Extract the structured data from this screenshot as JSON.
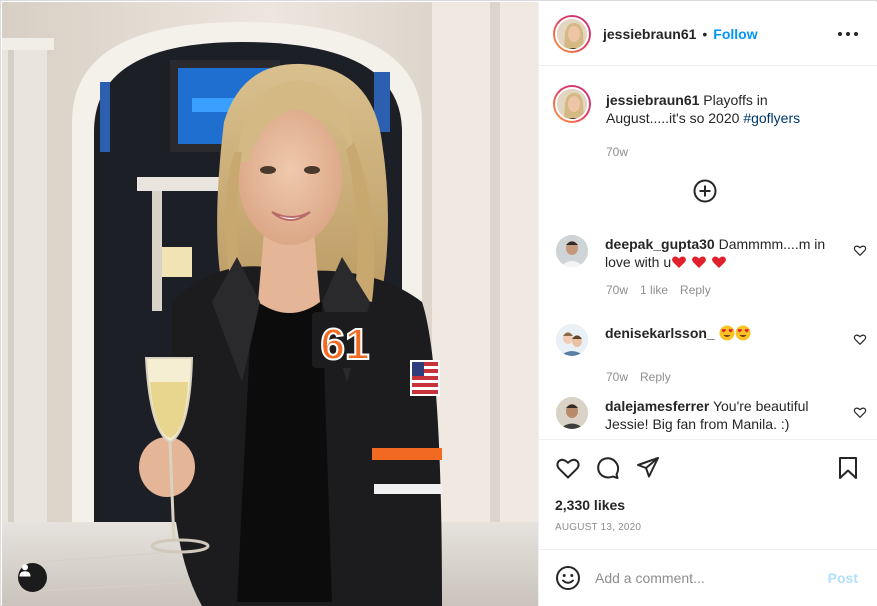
{
  "post": {
    "username": "jessiebraun61",
    "follow_label": "Follow",
    "separator": "•",
    "caption_text": "Playoffs in August.....it's so 2020",
    "caption_hashtag": "#goflyers",
    "caption_time": "70w",
    "jacket_number": "61",
    "likes": "2,330 likes",
    "date": "AUGUST 13, 2020"
  },
  "comments": [
    {
      "username": "deepak_gupta30",
      "text": "Dammmm....m in love with u",
      "emojis": [
        "heart",
        "heart",
        "heart"
      ],
      "time": "70w",
      "likes": "1 like",
      "reply": "Reply"
    },
    {
      "username": "denisekarlsson_",
      "text": "",
      "emojis": [
        "heart-eyes",
        "heart-eyes"
      ],
      "time": "70w",
      "reply": "Reply"
    },
    {
      "username": "dalejamesferrer",
      "text": "You're beautiful Jessie! Big fan from Manila. :)"
    }
  ],
  "composer": {
    "placeholder": "Add a comment...",
    "post_label": "Post"
  },
  "icons": {
    "more": "more-options-icon",
    "load_more": "plus-circle-icon",
    "like": "heart-icon",
    "comment": "comment-icon",
    "share": "paper-plane-icon",
    "save": "bookmark-icon",
    "emoji": "smiley-icon",
    "tag": "user-tag-icon"
  },
  "colors": {
    "accent": "#0095f6",
    "post_disabled": "#b2dffc",
    "muted": "#8e8e8e",
    "hashtag": "#00376b"
  }
}
